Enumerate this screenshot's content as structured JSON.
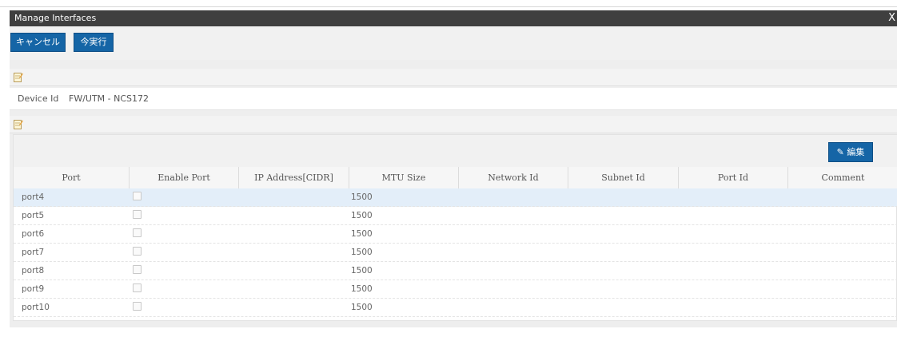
{
  "window": {
    "title": "Manage Interfaces",
    "close_label": "X"
  },
  "toolbar": {
    "cancel_label": "キャンセル",
    "execute_label": "今実行"
  },
  "device": {
    "label": "Device Id",
    "value": "FW/UTM - NCS172"
  },
  "grid": {
    "edit_label": "✎ 編集",
    "columns": [
      "Port",
      "Enable Port",
      "IP Address[CIDR]",
      "MTU Size",
      "Network Id",
      "Subnet Id",
      "Port Id",
      "Comment"
    ],
    "rows": [
      {
        "port": "port4",
        "enabled": false,
        "ip": "",
        "mtu": "1500",
        "network_id": "",
        "subnet_id": "",
        "port_id": "",
        "comment": "",
        "selected": true
      },
      {
        "port": "port5",
        "enabled": false,
        "ip": "",
        "mtu": "1500",
        "network_id": "",
        "subnet_id": "",
        "port_id": "",
        "comment": ""
      },
      {
        "port": "port6",
        "enabled": false,
        "ip": "",
        "mtu": "1500",
        "network_id": "",
        "subnet_id": "",
        "port_id": "",
        "comment": ""
      },
      {
        "port": "port7",
        "enabled": false,
        "ip": "",
        "mtu": "1500",
        "network_id": "",
        "subnet_id": "",
        "port_id": "",
        "comment": ""
      },
      {
        "port": "port8",
        "enabled": false,
        "ip": "",
        "mtu": "1500",
        "network_id": "",
        "subnet_id": "",
        "port_id": "",
        "comment": ""
      },
      {
        "port": "port9",
        "enabled": false,
        "ip": "",
        "mtu": "1500",
        "network_id": "",
        "subnet_id": "",
        "port_id": "",
        "comment": ""
      },
      {
        "port": "port10",
        "enabled": false,
        "ip": "",
        "mtu": "1500",
        "network_id": "",
        "subnet_id": "",
        "port_id": "",
        "comment": ""
      }
    ]
  },
  "colors": {
    "accent": "#1565a6",
    "titlebar": "#3f3f3f",
    "selected_row": "#e3eef9"
  }
}
